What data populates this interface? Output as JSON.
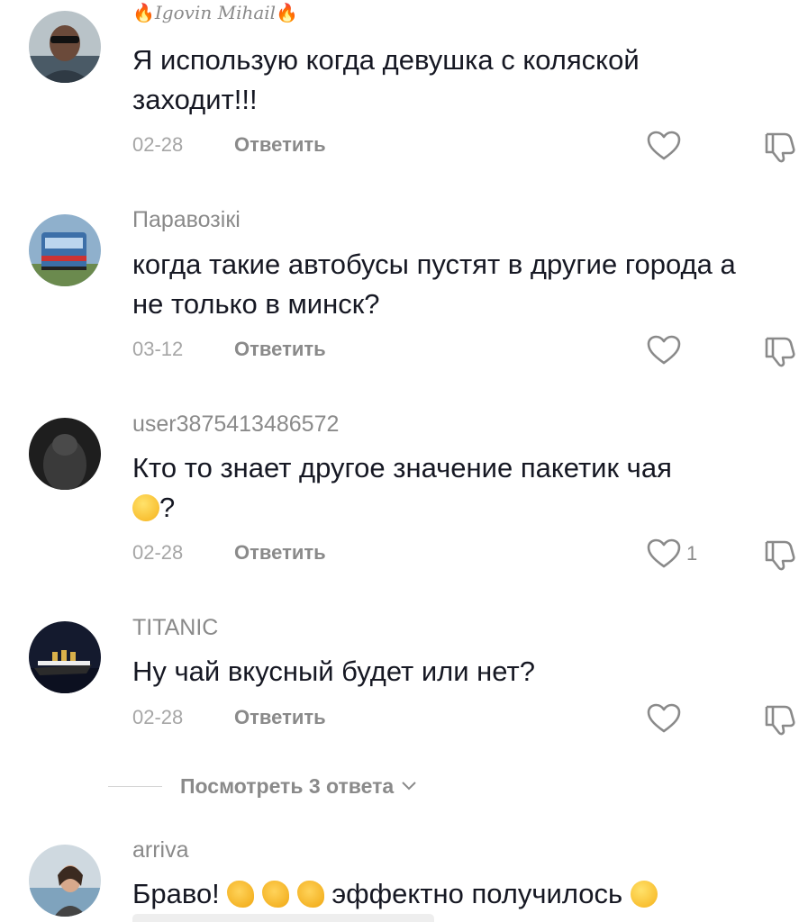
{
  "comments": [
    {
      "username": "Igovin Mihail",
      "text": "Я использую когда девушка с коляской заходит!!!",
      "date": "02-28",
      "reply_label": "Ответить",
      "likes": ""
    },
    {
      "username": "Паравозікі",
      "text": "когда такие автобусы пустят в другие города а не только в минск?",
      "date": "03-12",
      "reply_label": "Ответить",
      "likes": ""
    },
    {
      "username": "user3875413486572",
      "text": "Кто то знает другое значение пакетик чая",
      "text_suffix": "?",
      "date": "02-28",
      "reply_label": "Ответить",
      "likes": "1"
    },
    {
      "username": "TITANIC",
      "text": "Ну чай вкусный будет или нет?",
      "date": "02-28",
      "reply_label": "Ответить",
      "likes": ""
    },
    {
      "username": "arriva",
      "text_prefix": "Браво!",
      "text_suffix": "эффектно получилось"
    }
  ],
  "view_replies": "Посмотреть 3 ответа",
  "icons": {
    "like": "heart-outline-icon",
    "dislike": "thumbs-down-outline-icon",
    "expand": "chevron-down-icon"
  }
}
